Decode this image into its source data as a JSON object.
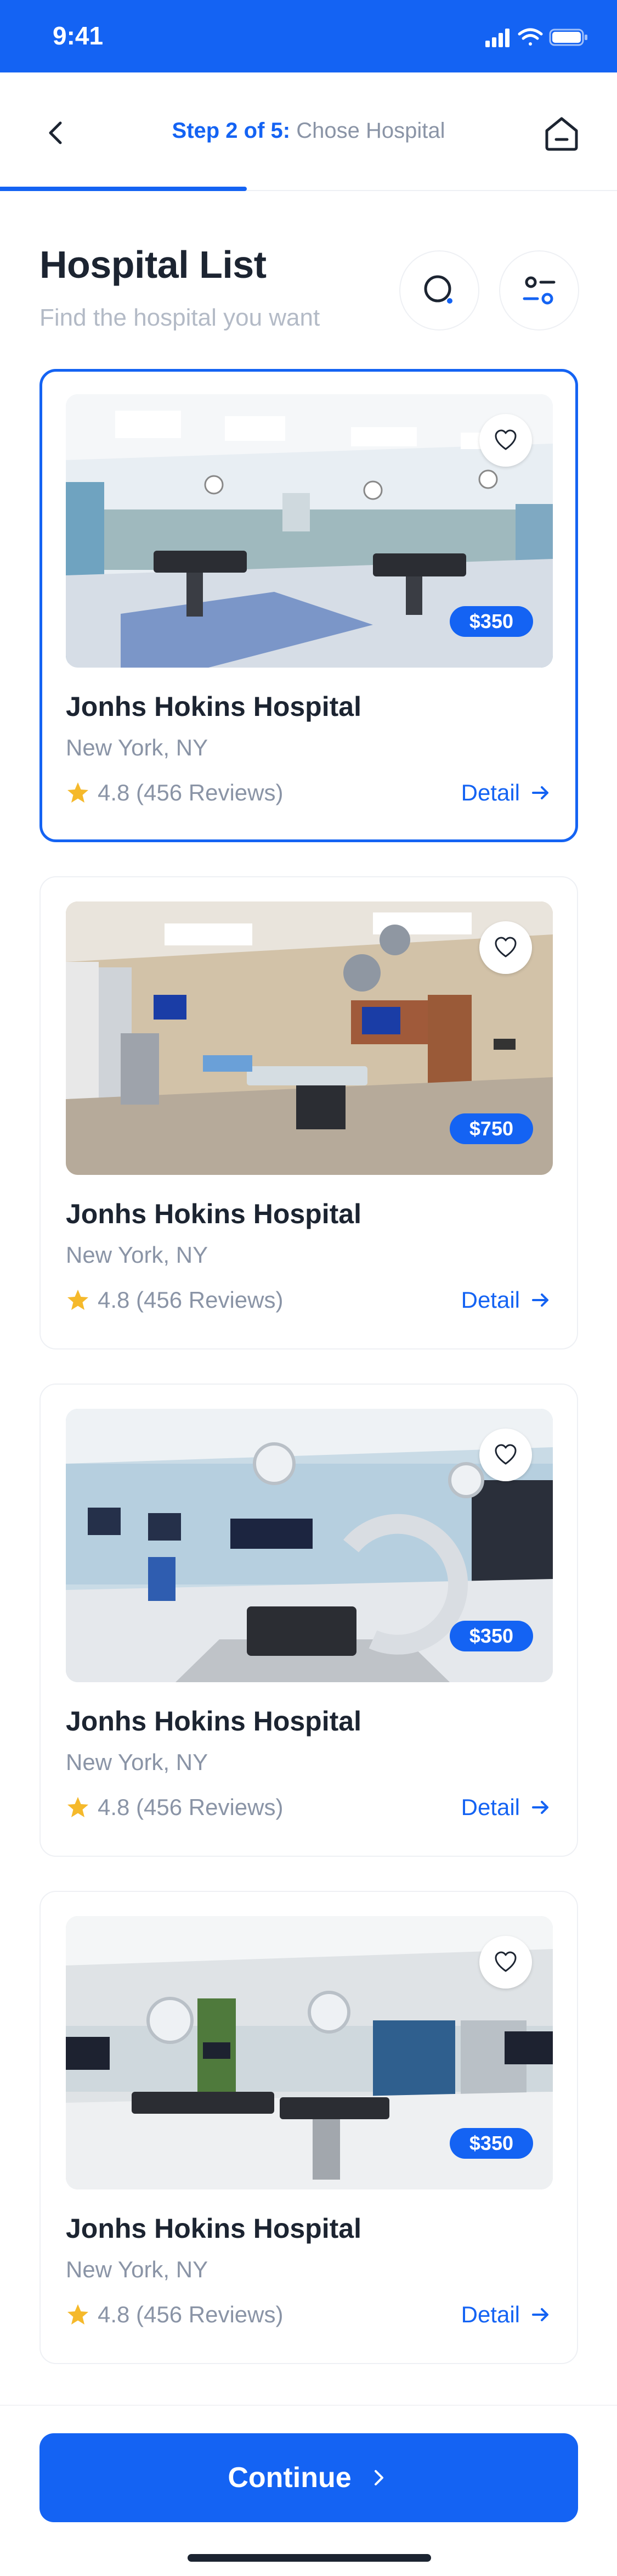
{
  "status": {
    "time": "9:41",
    "icons": [
      "signal-icon",
      "wifi-icon",
      "battery-icon"
    ]
  },
  "header": {
    "step_prefix": "Step 2 of 5:",
    "step_name": "Chose Hospital",
    "back_icon": "chevron-left-icon",
    "home_icon": "home-icon",
    "progress": 0.4
  },
  "page": {
    "title": "Hospital List",
    "subtitle": "Find the hospital you want",
    "search_icon": "search-icon",
    "filter_icon": "filter-icon"
  },
  "hospitals": [
    {
      "name": "Jonhs Hokins Hospital",
      "location": "New York, NY",
      "rating": "4.8 (456 Reviews)",
      "price": "$350",
      "detail": "Detail",
      "selected": true
    },
    {
      "name": "Jonhs Hokins Hospital",
      "location": "New York, NY",
      "rating": "4.8 (456 Reviews)",
      "price": "$750",
      "detail": "Detail",
      "selected": false
    },
    {
      "name": "Jonhs Hokins Hospital",
      "location": "New York, NY",
      "rating": "4.8 (456 Reviews)",
      "price": "$350",
      "detail": "Detail",
      "selected": false
    },
    {
      "name": "Jonhs Hokins Hospital",
      "location": "New York, NY",
      "rating": "4.8 (456 Reviews)",
      "price": "$350",
      "detail": "Detail",
      "selected": false
    }
  ],
  "footer": {
    "continue_label": "Continue"
  },
  "colors": {
    "accent": "#1463f3",
    "text": "#1c2431",
    "muted": "#8a94a6",
    "star": "#f5b92b"
  }
}
